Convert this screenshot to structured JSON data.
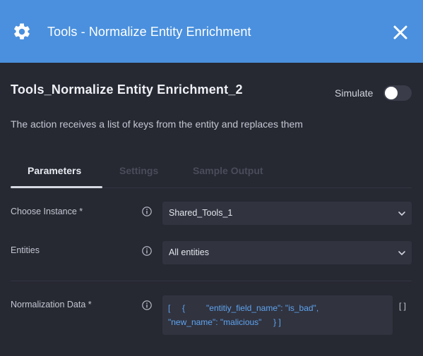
{
  "header": {
    "title": "Tools - Normalize Entity Enrichment",
    "icon": "gear-icon",
    "close_icon": "close-icon",
    "background_color": "#4a90de"
  },
  "action": {
    "name": "Tools_Normalize Entity Enrichment_2",
    "description": "The action receives a list of keys from the entity and replaces them",
    "simulate_label": "Simulate",
    "simulate_on": false
  },
  "tabs": [
    {
      "label": "Parameters",
      "active": true
    },
    {
      "label": "Settings",
      "active": false
    },
    {
      "label": "Sample Output",
      "active": false
    }
  ],
  "fields": {
    "instance": {
      "label": "Choose Instance *",
      "value": "Shared_Tools_1"
    },
    "entities": {
      "label": "Entities",
      "value": "All entities"
    },
    "normalization": {
      "label": "Normalization Data  *",
      "line1": "[     {         \"entitiy_field_name\": \"is_bad\",",
      "line2": "\"new_name\": \"malicious\"     } ]",
      "brackets": "[ ]"
    }
  }
}
